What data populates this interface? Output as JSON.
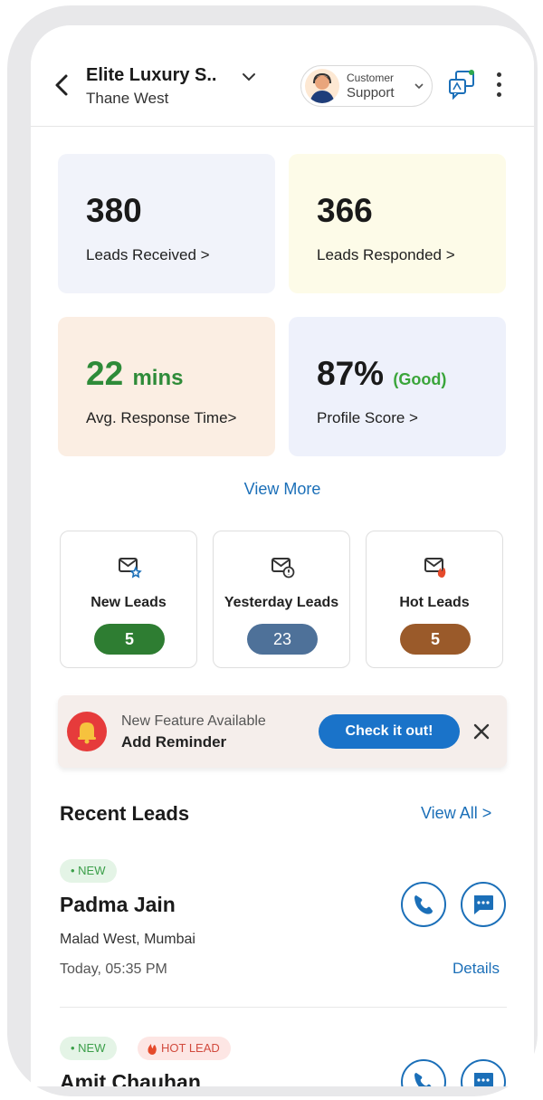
{
  "header": {
    "business_name": "Elite Luxury S..",
    "location": "Thane West",
    "support_small": "Customer",
    "support_big": "Support"
  },
  "stats": {
    "leads_received": {
      "value": "380",
      "label": "Leads Received >"
    },
    "leads_responded": {
      "value": "366",
      "label": "Leads Responded >"
    },
    "response_time": {
      "value": "22",
      "unit": "mins",
      "label": "Avg. Response Time>"
    },
    "profile_score": {
      "value": "87%",
      "rating": "(Good)",
      "label": "Profile Score >"
    }
  },
  "view_more": "View More",
  "lead_tiles": [
    {
      "label": "New Leads",
      "count": "5",
      "color": "#2e7d32"
    },
    {
      "label": "Yesterday Leads",
      "count": "23",
      "color": "#4e7199"
    },
    {
      "label": "Hot Leads",
      "count": "5",
      "color": "#9a5a2a"
    }
  ],
  "feature_banner": {
    "subtitle": "New Feature Available",
    "title": "Add Reminder",
    "button": "Check it out!"
  },
  "recent": {
    "title": "Recent Leads",
    "view_all": "View All >",
    "leads": [
      {
        "tag_new": "• NEW",
        "name": "Padma Jain",
        "location": "Malad West, Mumbai",
        "time": "Today, 05:35 PM",
        "details": "Details"
      },
      {
        "tag_new": "• NEW",
        "tag_hot": "HOT LEAD",
        "name": "Amit Chauhan"
      }
    ]
  },
  "colors": {
    "accent": "#1a73c9",
    "good": "#3aa53a"
  }
}
